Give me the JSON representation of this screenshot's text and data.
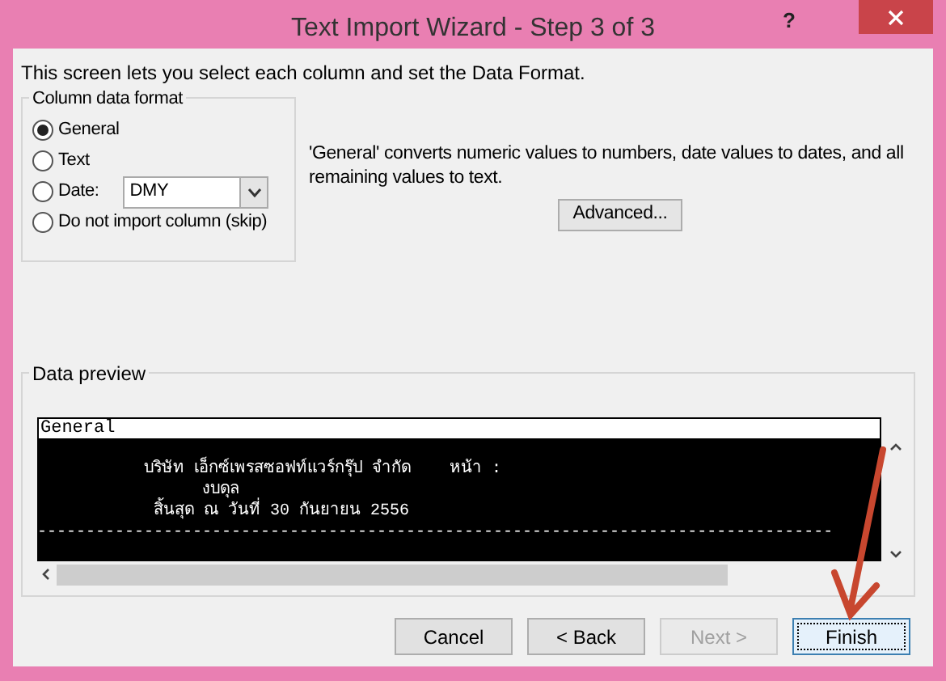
{
  "window": {
    "title": "Text Import Wizard - Step 3 of 3",
    "help": "?"
  },
  "intro": "This screen lets you select each column and set the Data Format.",
  "column_format": {
    "legend": "Column data format",
    "options": [
      {
        "label": "General",
        "selected": true,
        "kind": "plain"
      },
      {
        "label": "Text",
        "selected": false,
        "kind": "plain"
      },
      {
        "label": "Date:",
        "selected": false,
        "kind": "date",
        "dropdown": "DMY"
      },
      {
        "label": "Do not import column (skip)",
        "selected": false,
        "kind": "plain"
      }
    ]
  },
  "description": "'General' converts numeric values to numbers, date values to dates, and all remaining values to text.",
  "advanced_button": "Advanced...",
  "data_preview": {
    "legend": "Data preview",
    "header": "General",
    "lines": [
      "           บริษัท เอ็กซ์เพรสซอฟท์แวร์กรุ๊ป จำกัด    หน้า :",
      "                 งบดุล",
      "            สิ้นสุด ณ วันที่ 30 กันยายน 2556",
      "----------------------------------------------------------------------------------"
    ]
  },
  "buttons": [
    {
      "label": "Cancel",
      "disabled": false,
      "focused": false
    },
    {
      "label": "< Back",
      "disabled": false,
      "focused": false
    },
    {
      "label": "Next >",
      "disabled": true,
      "focused": false
    },
    {
      "label": "Finish",
      "disabled": false,
      "focused": true
    }
  ]
}
